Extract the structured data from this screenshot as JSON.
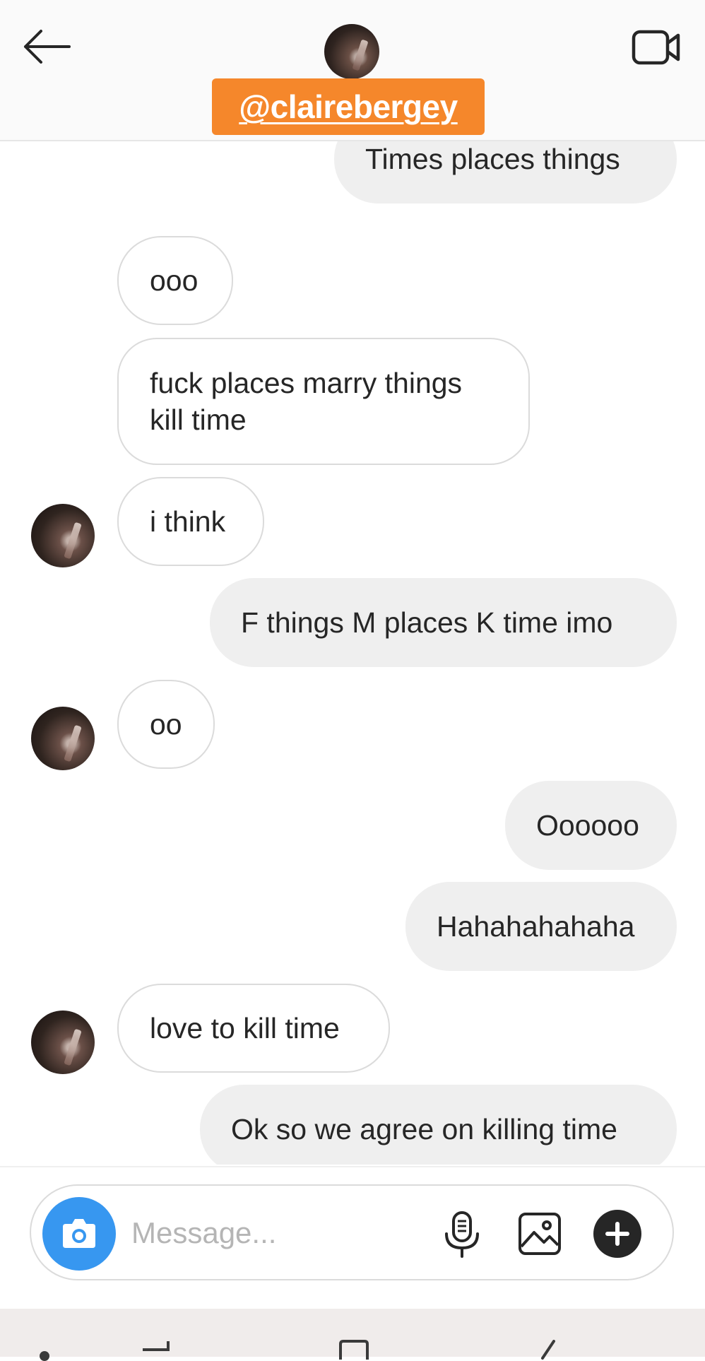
{
  "header": {
    "username": "@clairebergey"
  },
  "thread": {
    "messages": [
      {
        "direction": "out",
        "text": "Times places things"
      },
      {
        "direction": "in",
        "text": "ooo"
      },
      {
        "direction": "in",
        "text": "fuck places marry things kill time"
      },
      {
        "direction": "in",
        "text": "i think"
      },
      {
        "direction": "out",
        "text": "F things M places K time imo"
      },
      {
        "direction": "in",
        "text": "oo"
      },
      {
        "direction": "out",
        "text": "Oooooo"
      },
      {
        "direction": "out",
        "text": "Hahahahahaha"
      },
      {
        "direction": "in",
        "text": "love to kill time"
      },
      {
        "direction": "out",
        "text": "Ok so we agree on killing time"
      }
    ]
  },
  "composer": {
    "placeholder": "Message..."
  },
  "colors": {
    "username_tag_bg": "#f5872b",
    "camera_button": "#3797f0",
    "outgoing_bubble": "#efefef",
    "incoming_bubble_border": "#dbdbdb"
  }
}
